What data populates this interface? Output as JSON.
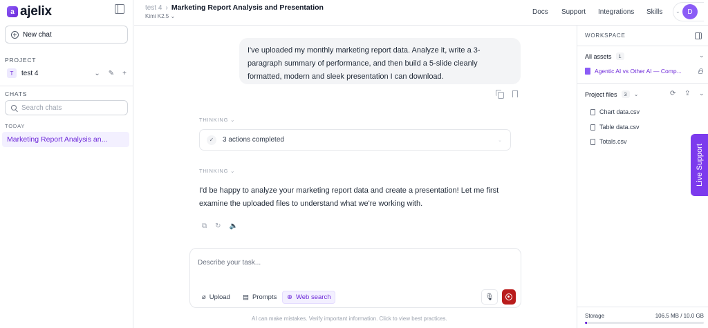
{
  "brand": {
    "name": "ajelix",
    "mark": "a"
  },
  "sidebar": {
    "new_chat_label": "New chat",
    "project_section": "PROJECT",
    "project_initial": "T",
    "project_name": "test 4",
    "chats_section": "CHATS",
    "search_placeholder": "Search chats",
    "today_label": "TODAY",
    "chats": [
      "Marketing Report Analysis an..."
    ]
  },
  "header": {
    "breadcrumb_project": "test 4",
    "breadcrumb_title": "Marketing Report Analysis and Presentation",
    "model": "Kimi K2.5",
    "nav": [
      "Docs",
      "Support",
      "Integrations",
      "Skills"
    ],
    "avatar_initial": "D"
  },
  "conversation": {
    "user_message": "I've uploaded my monthly marketing report data. Analyze it, write a 3-paragraph summary of performance, and then build a 5-slide cleanly formatted, modern and sleek presentation I can download.",
    "thinking_label": "THINKING",
    "actions_completed": "3 actions completed",
    "assistant_reply": "I'd be happy to analyze your marketing report data and create a presentation! Let me first examine the uploaded files to understand what we're working with."
  },
  "composer": {
    "placeholder": "Describe your task...",
    "upload_label": "Upload",
    "prompts_label": "Prompts",
    "web_search_label": "Web search",
    "disclaimer": "AI can make mistakes. Verify important information. Click to view best practices."
  },
  "workspace": {
    "title": "WORKSPACE",
    "all_assets_label": "All assets",
    "all_assets_count": "1",
    "asset_name": "Agentic AI vs Other AI — Comp...",
    "project_files_label": "Project files",
    "project_files_count": "3",
    "files": [
      "Chart data.csv",
      "Table data.csv",
      "Totals.csv"
    ],
    "storage_label": "Storage",
    "storage_value": "106.5 MB / 10.0 GB",
    "storage_fraction": 0.0104
  },
  "live_support_label": "Live Support",
  "colors": {
    "accent": "#6d28d9",
    "stop": "#b91c1c",
    "live_support": "#7c3aed"
  }
}
